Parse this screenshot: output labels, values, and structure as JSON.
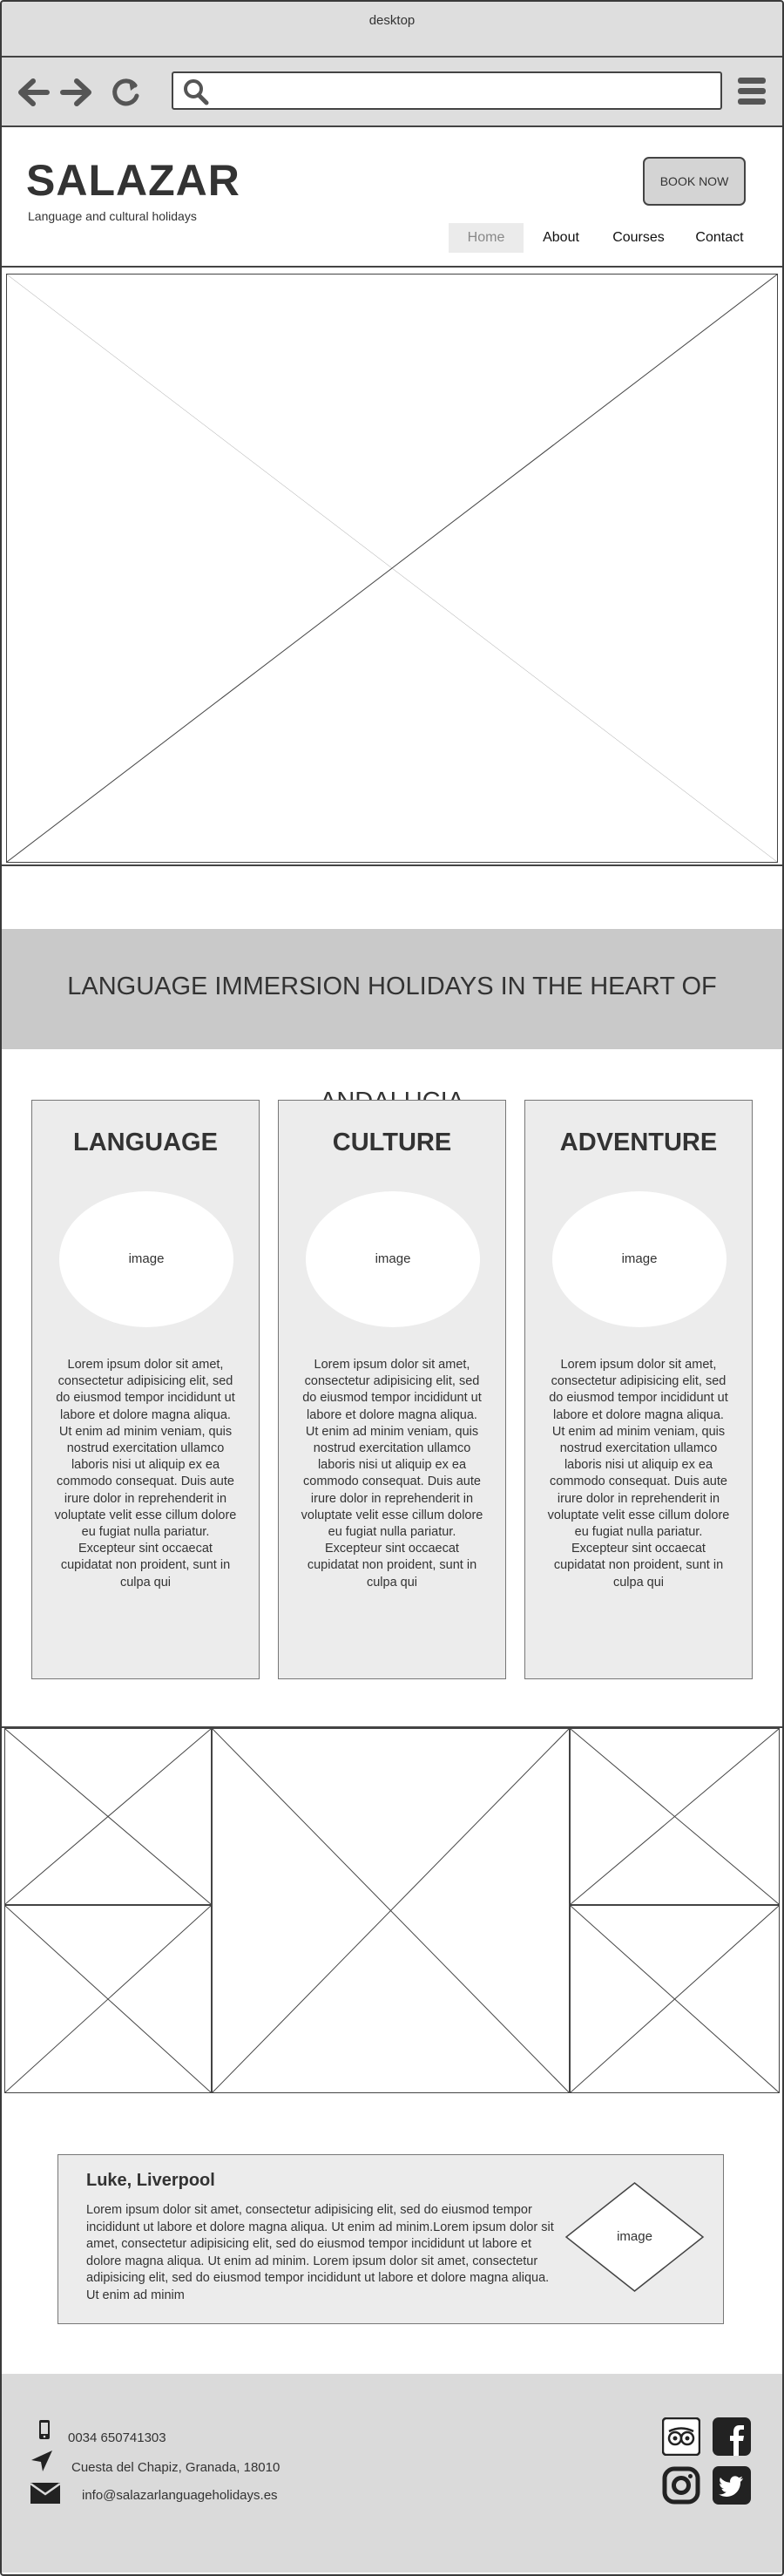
{
  "browser": {
    "title": "desktop"
  },
  "header": {
    "brand": "SALAZAR",
    "tagline": "Language and cultural holidays",
    "book_now": "BOOK NOW",
    "nav": [
      {
        "label": "Home",
        "active": true
      },
      {
        "label": "About"
      },
      {
        "label": "Courses"
      },
      {
        "label": "Contact"
      }
    ]
  },
  "banner": {
    "text": "LANGUAGE IMMERSION HOLIDAYS IN THE HEART OF ANDALUCIA"
  },
  "features": [
    {
      "title": "LANGUAGE",
      "image_label": "image",
      "body": "Lorem ipsum dolor sit amet, consectetur adipisicing elit, sed do eiusmod tempor incididunt ut labore et dolore magna aliqua. Ut enim ad minim veniam, quis nostrud exercitation ullamco laboris nisi ut aliquip ex ea commodo consequat. Duis aute irure dolor in reprehenderit in voluptate velit esse cillum dolore eu fugiat nulla pariatur. Excepteur sint occaecat cupidatat non proident, sunt in culpa qui"
    },
    {
      "title": "CULTURE",
      "image_label": "image",
      "body": "Lorem ipsum dolor sit amet, consectetur adipisicing elit, sed do eiusmod tempor incididunt ut labore et dolore magna aliqua. Ut enim ad minim veniam, quis nostrud exercitation ullamco laboris nisi ut aliquip ex ea commodo consequat. Duis aute irure dolor in reprehenderit in voluptate velit esse cillum dolore eu fugiat nulla pariatur. Excepteur sint occaecat cupidatat non proident, sunt in culpa qui"
    },
    {
      "title": "ADVENTURE",
      "image_label": "image",
      "body": "Lorem ipsum dolor sit amet, consectetur adipisicing elit, sed do eiusmod tempor incididunt ut labore et dolore magna aliqua. Ut enim ad minim veniam, quis nostrud exercitation ullamco laboris nisi ut aliquip ex ea commodo consequat. Duis aute irure dolor in reprehenderit in voluptate velit esse cillum dolore eu fugiat nulla pariatur. Excepteur sint occaecat cupidatat non proident, sunt in culpa qui"
    }
  ],
  "testimonial": {
    "author": "Luke, Liverpool",
    "body": "Lorem ipsum dolor sit amet, consectetur adipisicing elit, sed do eiusmod tempor incididunt ut labore et dolore magna aliqua. Ut enim ad minim.Lorem ipsum dolor sit amet, consectetur adipisicing elit, sed do eiusmod tempor incididunt ut labore et dolore magna aliqua. Ut enim ad minim. Lorem ipsum dolor sit amet, consectetur adipisicing elit, sed do eiusmod tempor incididunt ut labore et dolore magna aliqua. Ut enim ad minim",
    "image_label": "image"
  },
  "footer": {
    "phone": "0034 650741303",
    "address": "Cuesta del Chapiz, Granada, 18010",
    "email": "info@salazarlanguageholidays.es",
    "social_icons": [
      "tripadvisor-icon",
      "facebook-icon",
      "instagram-icon",
      "twitter-icon"
    ]
  },
  "colors": {
    "chrome": "#dedede",
    "banner": "#c9c9c9",
    "card": "#ececec",
    "footer": "#dadada",
    "ink": "#333333"
  }
}
